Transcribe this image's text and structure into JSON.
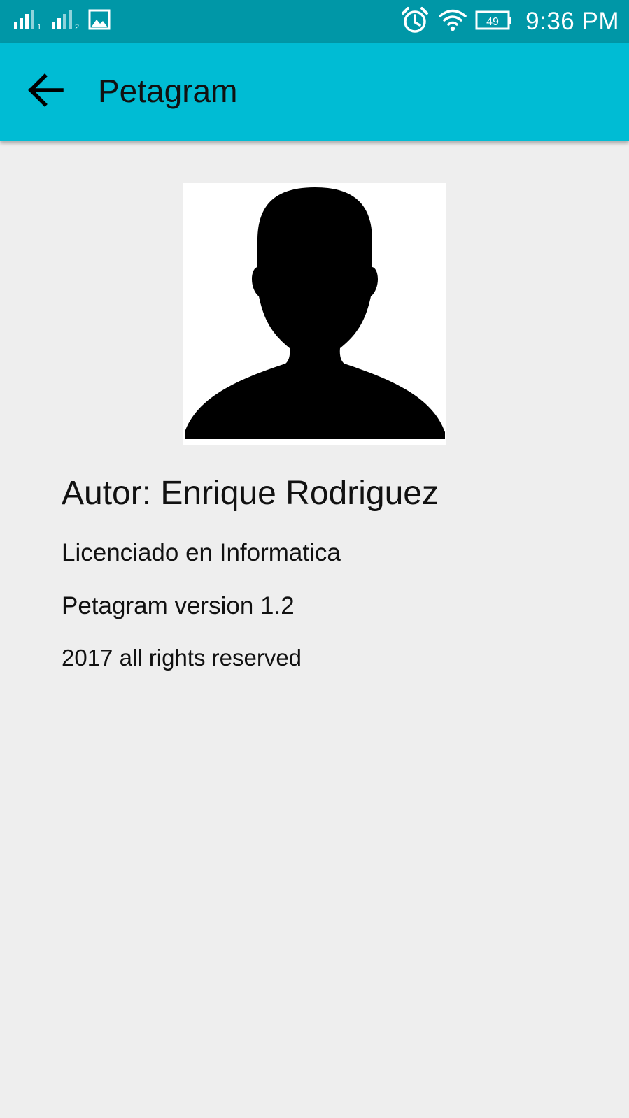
{
  "status_bar": {
    "sim1_indicator": "1",
    "sim2_indicator": "2",
    "battery_level": "49",
    "time": "9:36 PM",
    "icons": [
      "signal-sim1-icon",
      "signal-sim2-icon",
      "gallery-notification-icon",
      "alarm-icon",
      "wifi-icon",
      "battery-icon"
    ]
  },
  "app_bar": {
    "title": "Petagram",
    "back_icon": "arrow-back-icon",
    "background_color": "#00bcd4"
  },
  "profile": {
    "avatar": "person-silhouette",
    "author": "Autor: Enrique Rodriguez",
    "degree": "Licenciado en Informatica",
    "version": "Petagram version 1.2",
    "rights": "2017 all rights reserved"
  },
  "colors": {
    "status_bar": "#0097a7",
    "app_bar": "#00bcd4",
    "background": "#eeeeee"
  }
}
